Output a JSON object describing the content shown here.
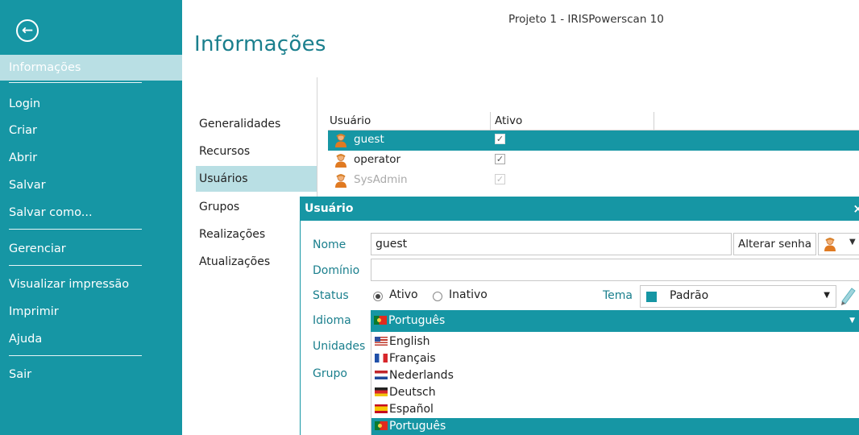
{
  "window": {
    "title": "Projeto 1 - IRISPowerscan 10"
  },
  "sidebar": {
    "back_icon": "arrow-left-circle-icon",
    "items": [
      {
        "label": "Informações",
        "active": true
      },
      {
        "label": "Login"
      },
      {
        "label": "Criar"
      },
      {
        "label": "Abrir"
      },
      {
        "label": "Salvar"
      },
      {
        "label": "Salvar como..."
      },
      {
        "label": "Gerenciar"
      },
      {
        "label": "Visualizar impressão"
      },
      {
        "label": "Imprimir"
      },
      {
        "label": "Ajuda"
      },
      {
        "label": "Sair"
      }
    ]
  },
  "page": {
    "title": "Informações"
  },
  "subnav": {
    "items": [
      {
        "label": "Generalidades"
      },
      {
        "label": "Recursos"
      },
      {
        "label": "Usuários",
        "active": true
      },
      {
        "label": "Grupos"
      },
      {
        "label": "Realizações"
      },
      {
        "label": "Atualizações"
      }
    ]
  },
  "users_table": {
    "columns": [
      "Usuário",
      "Ativo"
    ],
    "rows": [
      {
        "name": "guest",
        "active_mark": "✓",
        "selected": true
      },
      {
        "name": "operator",
        "active_mark": "✓"
      },
      {
        "name": "SysAdmin",
        "active_mark": "✓",
        "disabled": true
      }
    ]
  },
  "dialog": {
    "title": "Usuário",
    "close_glyph": "×",
    "labels": {
      "nome": "Nome",
      "dominio": "Domínio",
      "status": "Status",
      "tema": "Tema",
      "idioma": "Idioma",
      "unidades": "Unidades",
      "grupo": "Grupo"
    },
    "nome_value": "guest",
    "dominio_value": "",
    "change_password_label": "Alterar senha",
    "status_options": [
      {
        "label": "Ativo",
        "checked": true
      },
      {
        "label": "Inativo",
        "checked": false
      }
    ],
    "tema_value": "Padrão",
    "tema_color": "#1696a4",
    "idioma_value": "Português",
    "languages": [
      {
        "label": "English",
        "flag": "flag-us-icon"
      },
      {
        "label": "Français",
        "flag": "flag-fr-icon"
      },
      {
        "label": "Nederlands",
        "flag": "flag-nl-icon"
      },
      {
        "label": "Deutsch",
        "flag": "flag-de-icon"
      },
      {
        "label": "Español",
        "flag": "flag-es-icon"
      },
      {
        "label": "Português",
        "flag": "flag-pt-icon",
        "selected": true
      }
    ]
  },
  "colors": {
    "accent": "#1696a4",
    "highlight": "#b9dfe4",
    "label_teal": "#1a7f8d"
  }
}
